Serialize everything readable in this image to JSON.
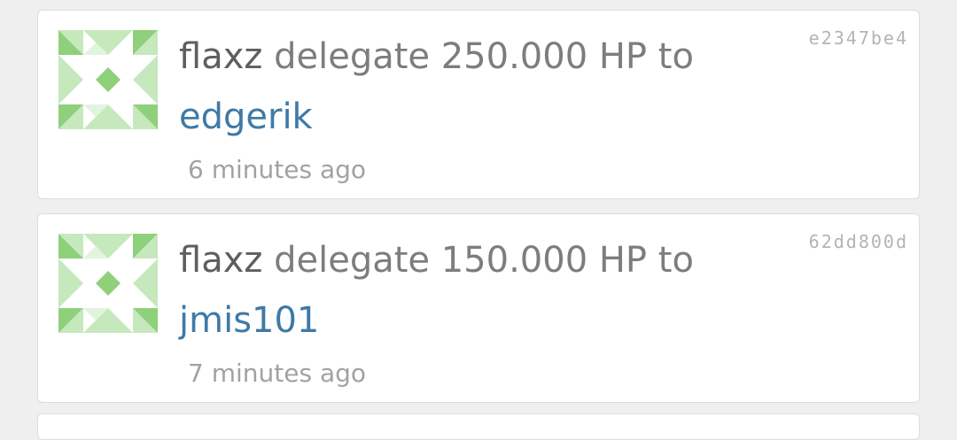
{
  "feed": {
    "items": [
      {
        "author": "flaxz",
        "action": "delegate 250.000 HP to",
        "target": "edgerik",
        "time": "6 minutes ago",
        "hash": "e2347be4",
        "avatar_icon": "identicon-icon",
        "avatar_colors": {
          "light": "#c6e8bd",
          "dark": "#8fd07b"
        }
      },
      {
        "author": "flaxz",
        "action": "delegate 150.000 HP to",
        "target": "jmis101",
        "time": "7 minutes ago",
        "hash": "62dd800d",
        "avatar_icon": "identicon-icon",
        "avatar_colors": {
          "light": "#c6e8bd",
          "dark": "#8fd07b"
        }
      }
    ]
  },
  "colors": {
    "background": "#efefef",
    "card": "#ffffff",
    "author": "#5e5e5e",
    "action": "#7d7d7d",
    "link": "#3f7aa6",
    "time": "#a2a2a2",
    "hash": "#b4b4b4"
  }
}
